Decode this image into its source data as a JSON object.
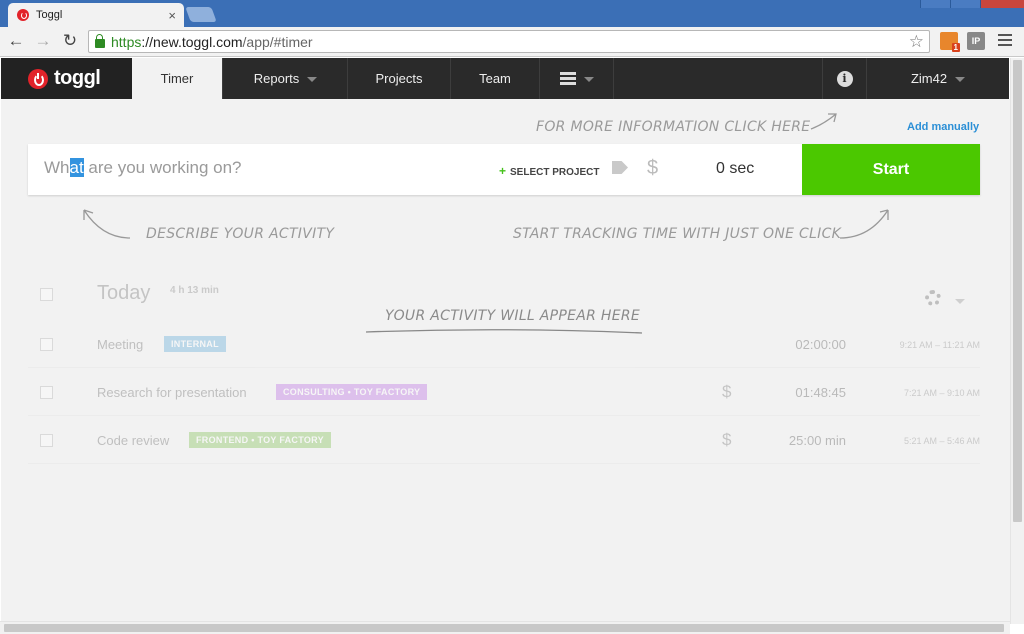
{
  "browser": {
    "tab_title": "Toggl",
    "tab_close": "×",
    "url_scheme": "https",
    "url_host": "://new.toggl.com",
    "url_path": "/app/#timer",
    "ext1_label": "1",
    "ext2_label": "IP"
  },
  "header": {
    "logo": "toggl",
    "nav": {
      "timer": "Timer",
      "reports": "Reports",
      "projects": "Projects",
      "team": "Team"
    },
    "info": "i",
    "user": "Zim42"
  },
  "hints": {
    "more_info": "For more information click here",
    "describe": "Describe your activity",
    "start_tracking": "Start tracking time with just one click",
    "activity_appear": "Your activity will appear here"
  },
  "timer": {
    "add_manually": "Add manually",
    "desc_pre": "Wh",
    "desc_sel": "at",
    "desc_post": " are you working on?",
    "select_project": "SELECT PROJECT",
    "dollar": "$",
    "duration": "0 sec",
    "start": "Start"
  },
  "list": {
    "day": "Today",
    "total": "4 h 13 min",
    "entries": [
      {
        "desc": "Meeting",
        "tag": "INTERNAL",
        "tag_color": "#4aa0d6",
        "billable": false,
        "duration": "02:00:00",
        "time": "9:21 AM – 11:21 AM"
      },
      {
        "desc": "Research for presentation",
        "tag": "CONSULTING  •  TOY FACTORY",
        "tag_color": "#b35ae0",
        "billable": true,
        "duration": "01:48:45",
        "time": "7:21 AM – 9:10 AM"
      },
      {
        "desc": "Code review",
        "tag": "FRONTEND  •  TOY FACTORY",
        "tag_color": "#6fb83a",
        "billable": true,
        "duration": "25:00 min",
        "time": "5:21 AM – 5:46 AM"
      }
    ]
  },
  "colors": {
    "accent": "#4bc800",
    "header_bg": "#2a2a2a",
    "brand_red": "#e2232a",
    "link": "#2b8fd6"
  }
}
